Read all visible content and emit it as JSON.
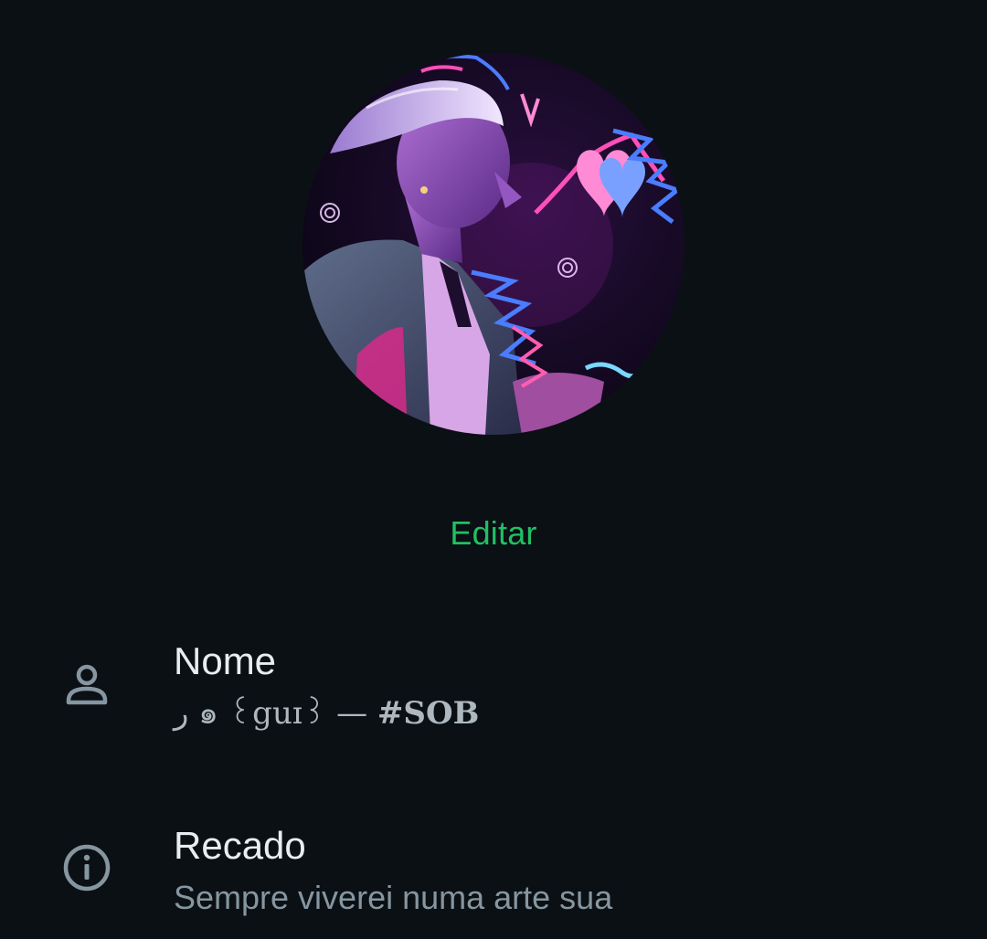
{
  "profile": {
    "edit_label": "Editar",
    "rows": [
      {
        "icon": "person-icon",
        "label": "Nome",
        "value_prefix": "ر ๑ ꒰guɪ꒱ — ",
        "value_tag": "#SOB"
      },
      {
        "icon": "info-icon",
        "label": "Recado",
        "value": "Sempre viverei numa arte sua"
      }
    ]
  },
  "colors": {
    "background": "#0b1014",
    "accent": "#21c063",
    "primary_text": "#e9edef",
    "secondary_text": "#8696a0",
    "icon": "#8696a0"
  }
}
